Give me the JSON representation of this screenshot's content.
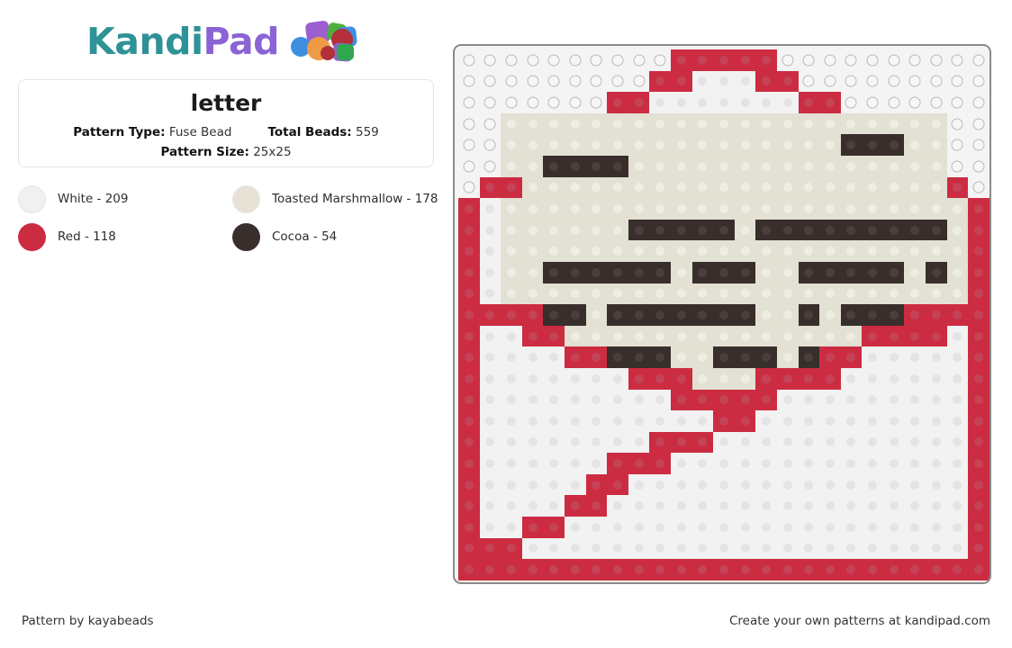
{
  "brand": {
    "name_part1": "Kandi",
    "name_part2": "Pad",
    "color_teal": "#2f9296",
    "color_purple": "#8b63d4",
    "bead_colors": [
      "#9b5fd0",
      "#3f8fe0",
      "#ef9a45",
      "#b3303a",
      "#4caf3e",
      "#2fa84f",
      "#8e63cf"
    ]
  },
  "info": {
    "title": "letter",
    "pattern_type_label": "Pattern Type:",
    "pattern_type_value": "Fuse Bead",
    "total_beads_label": "Total Beads:",
    "total_beads_value": "559",
    "pattern_size_label": "Pattern Size:",
    "pattern_size_value": "25x25"
  },
  "legend": [
    {
      "name": "White",
      "count": 209,
      "label": "White - 209",
      "hex": "#f0f0f0",
      "ring": true
    },
    {
      "name": "Toasted Marshmallow",
      "count": 178,
      "label": "Toasted Marshmallow - 178",
      "hex": "#e6e2d6",
      "ring": true
    },
    {
      "name": "Red",
      "count": 118,
      "label": "Red - 118",
      "hex": "#cc2c41",
      "ring": false
    },
    {
      "name": "Cocoa",
      "count": 54,
      "label": "Cocoa - 54",
      "hex": "#382e2b",
      "ring": false
    }
  ],
  "board": {
    "rows": 25,
    "cols": 25,
    "palette": {
      "e": "empty",
      "w": "White",
      "m": "Toasted Marshmallow",
      "r": "Red",
      "c": "Cocoa"
    },
    "cells": [
      "eeeeeeeeeerrrrreeeeeeeeee",
      "eeeeeeeeerrwwwrreeeeeeeee",
      "eeeeeeerrwwwwwwwrreeeeeee",
      "eemmmmmmmmmmmmmmmmmmmmmee",
      "eemmmmmmmmmmmmmmmmcccmmee",
      "eemmccccmmmmmmmmmmmmmmmee",
      "errmmmmmmmmmmmmmmmmmmmmre",
      "rwmmmmmmmmmmmmmmmmmmmmmmr",
      "rwmmmmmmcccccmcccccccccmr",
      "rwmmmmmmmmmmmmmmmmmmmmmmr",
      "rwmmccccccmcccmmcccccmcmr",
      "rwmmmmmmmmmmmmmmmmmmmmmmr",
      "rrrrccmcccccccmmcmcccrrrr",
      "rwwrrmmmmmmmmmmmmmmrrrrwr",
      "rwwwwrrcccmmcccmcrrwwwwwr",
      "rwwwwwwwrrrmmmrrrrwwwwwwr",
      "rwwwwwwwwwrrrrrwwwwwwwwwr",
      "rwwwwwwwwwwwrrwwwwwwwwwwr",
      "rwwwwwwwwrrrwwwwwwwwwwwwr",
      "rwwwwwwrrrwwwwwwwwwwwwwwr",
      "rwwwwwrrwwwwwwwwwwwwwwwwr",
      "rwwwwrrwwwwwwwwwwwwwwwwwr",
      "rwwrrwwwwwwwwwwwwwwwwwwwr",
      "rrrwwwwwwwwwwwwwwwwwwwwwr",
      "rrrrrrrrrrrrrrrrrrrrrrrrr"
    ]
  },
  "footer": {
    "credit_prefix": "Pattern by ",
    "credit_author": "kayabeads",
    "cta_prefix": "Create your own patterns at ",
    "cta_site": "kandipad.com"
  }
}
